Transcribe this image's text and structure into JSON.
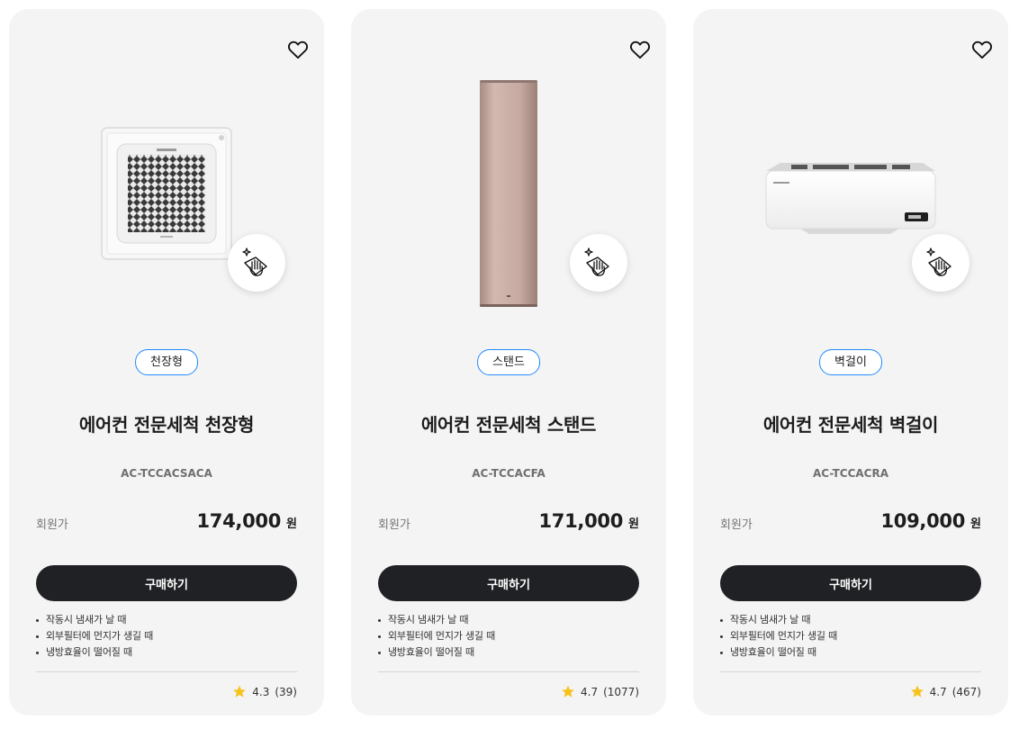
{
  "products": [
    {
      "type_tag": "천장형",
      "title": "에어컨 전문세척 천장형",
      "model": "AC-TCCACSACA",
      "price_label": "회원가",
      "price": "174,000",
      "currency": "원",
      "buy_label": "구매하기",
      "bullets": [
        "작동시 냄새가 날 때",
        "외부필터에 먼지가 생길 때",
        "냉방효율이 떨어질 때"
      ],
      "rating": "4.3",
      "review_count": "(39)",
      "image_icon": "ceiling-cassette-ac-image"
    },
    {
      "type_tag": "스탠드",
      "title": "에어컨 전문세척 스탠드",
      "model": "AC-TCCACFA",
      "price_label": "회원가",
      "price": "171,000",
      "currency": "원",
      "buy_label": "구매하기",
      "bullets": [
        "작동시 냄새가 날 때",
        "외부필터에 먼지가 생길 때",
        "냉방효율이 떨어질 때"
      ],
      "rating": "4.7",
      "review_count": "(1077)",
      "image_icon": "stand-ac-image"
    },
    {
      "type_tag": "벽걸이",
      "title": "에어컨 전문세척 벽걸이",
      "model": "AC-TCCACRA",
      "price_label": "회원가",
      "price": "109,000",
      "currency": "원",
      "buy_label": "구매하기",
      "bullets": [
        "작동시 냄새가 날 때",
        "외부필터에 먼지가 생길 때",
        "냉방효율이 떨어질 때"
      ],
      "rating": "4.7",
      "review_count": "(467)",
      "image_icon": "wall-mounted-ac-image"
    }
  ],
  "colors": {
    "card_bg": "#f4f4f4",
    "button_bg": "#1f2124",
    "tag_border": "#2189ff",
    "star": "#f6c31c",
    "stand_ac": "#c8a9a0"
  },
  "icons": {
    "wishlist": "heart-outline-icon",
    "cleaning": "hand-wipe-sparkle-icon",
    "rating": "star-icon"
  }
}
